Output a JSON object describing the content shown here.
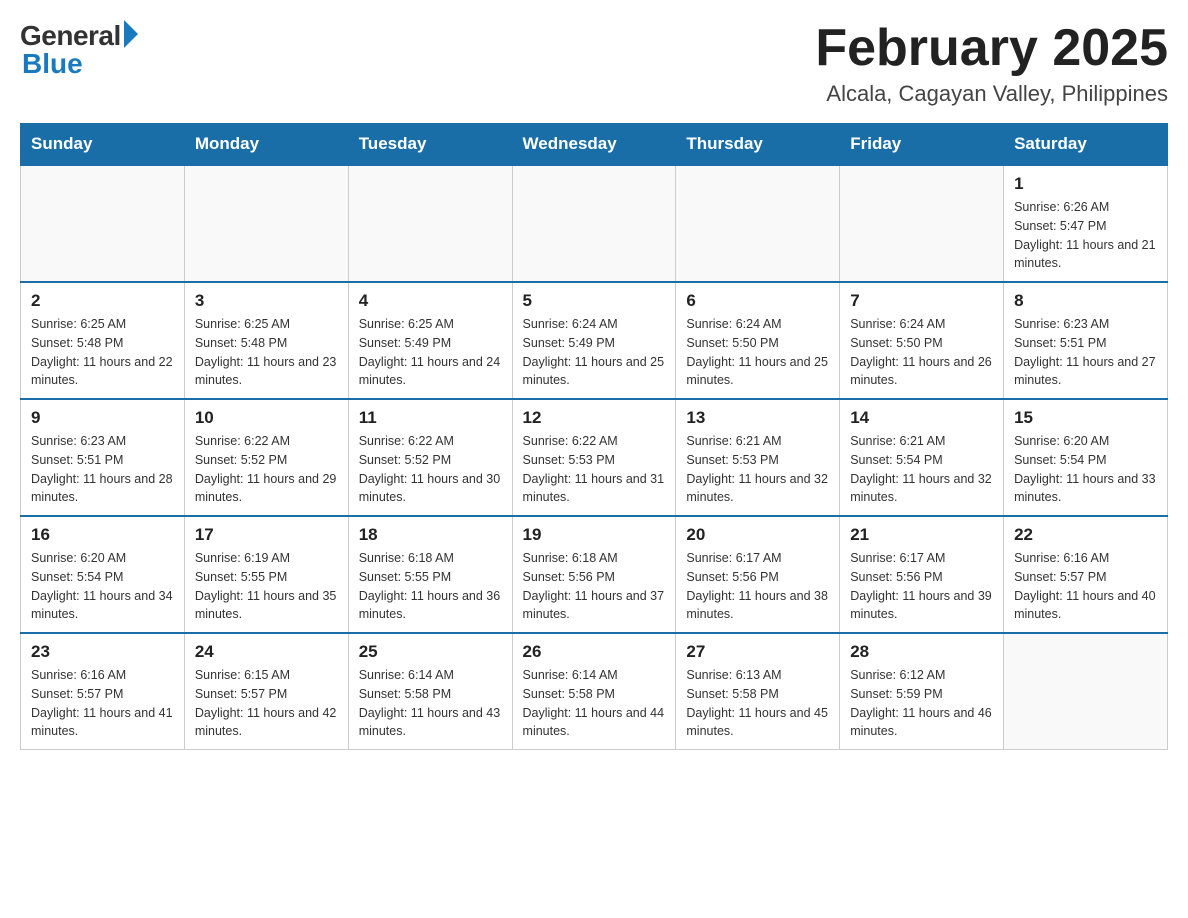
{
  "logo": {
    "general": "General",
    "blue": "Blue"
  },
  "title": {
    "month_year": "February 2025",
    "location": "Alcala, Cagayan Valley, Philippines"
  },
  "weekdays": [
    "Sunday",
    "Monday",
    "Tuesday",
    "Wednesday",
    "Thursday",
    "Friday",
    "Saturday"
  ],
  "weeks": [
    [
      {
        "day": "",
        "info": ""
      },
      {
        "day": "",
        "info": ""
      },
      {
        "day": "",
        "info": ""
      },
      {
        "day": "",
        "info": ""
      },
      {
        "day": "",
        "info": ""
      },
      {
        "day": "",
        "info": ""
      },
      {
        "day": "1",
        "info": "Sunrise: 6:26 AM\nSunset: 5:47 PM\nDaylight: 11 hours and 21 minutes."
      }
    ],
    [
      {
        "day": "2",
        "info": "Sunrise: 6:25 AM\nSunset: 5:48 PM\nDaylight: 11 hours and 22 minutes."
      },
      {
        "day": "3",
        "info": "Sunrise: 6:25 AM\nSunset: 5:48 PM\nDaylight: 11 hours and 23 minutes."
      },
      {
        "day": "4",
        "info": "Sunrise: 6:25 AM\nSunset: 5:49 PM\nDaylight: 11 hours and 24 minutes."
      },
      {
        "day": "5",
        "info": "Sunrise: 6:24 AM\nSunset: 5:49 PM\nDaylight: 11 hours and 25 minutes."
      },
      {
        "day": "6",
        "info": "Sunrise: 6:24 AM\nSunset: 5:50 PM\nDaylight: 11 hours and 25 minutes."
      },
      {
        "day": "7",
        "info": "Sunrise: 6:24 AM\nSunset: 5:50 PM\nDaylight: 11 hours and 26 minutes."
      },
      {
        "day": "8",
        "info": "Sunrise: 6:23 AM\nSunset: 5:51 PM\nDaylight: 11 hours and 27 minutes."
      }
    ],
    [
      {
        "day": "9",
        "info": "Sunrise: 6:23 AM\nSunset: 5:51 PM\nDaylight: 11 hours and 28 minutes."
      },
      {
        "day": "10",
        "info": "Sunrise: 6:22 AM\nSunset: 5:52 PM\nDaylight: 11 hours and 29 minutes."
      },
      {
        "day": "11",
        "info": "Sunrise: 6:22 AM\nSunset: 5:52 PM\nDaylight: 11 hours and 30 minutes."
      },
      {
        "day": "12",
        "info": "Sunrise: 6:22 AM\nSunset: 5:53 PM\nDaylight: 11 hours and 31 minutes."
      },
      {
        "day": "13",
        "info": "Sunrise: 6:21 AM\nSunset: 5:53 PM\nDaylight: 11 hours and 32 minutes."
      },
      {
        "day": "14",
        "info": "Sunrise: 6:21 AM\nSunset: 5:54 PM\nDaylight: 11 hours and 32 minutes."
      },
      {
        "day": "15",
        "info": "Sunrise: 6:20 AM\nSunset: 5:54 PM\nDaylight: 11 hours and 33 minutes."
      }
    ],
    [
      {
        "day": "16",
        "info": "Sunrise: 6:20 AM\nSunset: 5:54 PM\nDaylight: 11 hours and 34 minutes."
      },
      {
        "day": "17",
        "info": "Sunrise: 6:19 AM\nSunset: 5:55 PM\nDaylight: 11 hours and 35 minutes."
      },
      {
        "day": "18",
        "info": "Sunrise: 6:18 AM\nSunset: 5:55 PM\nDaylight: 11 hours and 36 minutes."
      },
      {
        "day": "19",
        "info": "Sunrise: 6:18 AM\nSunset: 5:56 PM\nDaylight: 11 hours and 37 minutes."
      },
      {
        "day": "20",
        "info": "Sunrise: 6:17 AM\nSunset: 5:56 PM\nDaylight: 11 hours and 38 minutes."
      },
      {
        "day": "21",
        "info": "Sunrise: 6:17 AM\nSunset: 5:56 PM\nDaylight: 11 hours and 39 minutes."
      },
      {
        "day": "22",
        "info": "Sunrise: 6:16 AM\nSunset: 5:57 PM\nDaylight: 11 hours and 40 minutes."
      }
    ],
    [
      {
        "day": "23",
        "info": "Sunrise: 6:16 AM\nSunset: 5:57 PM\nDaylight: 11 hours and 41 minutes."
      },
      {
        "day": "24",
        "info": "Sunrise: 6:15 AM\nSunset: 5:57 PM\nDaylight: 11 hours and 42 minutes."
      },
      {
        "day": "25",
        "info": "Sunrise: 6:14 AM\nSunset: 5:58 PM\nDaylight: 11 hours and 43 minutes."
      },
      {
        "day": "26",
        "info": "Sunrise: 6:14 AM\nSunset: 5:58 PM\nDaylight: 11 hours and 44 minutes."
      },
      {
        "day": "27",
        "info": "Sunrise: 6:13 AM\nSunset: 5:58 PM\nDaylight: 11 hours and 45 minutes."
      },
      {
        "day": "28",
        "info": "Sunrise: 6:12 AM\nSunset: 5:59 PM\nDaylight: 11 hours and 46 minutes."
      },
      {
        "day": "",
        "info": ""
      }
    ]
  ]
}
